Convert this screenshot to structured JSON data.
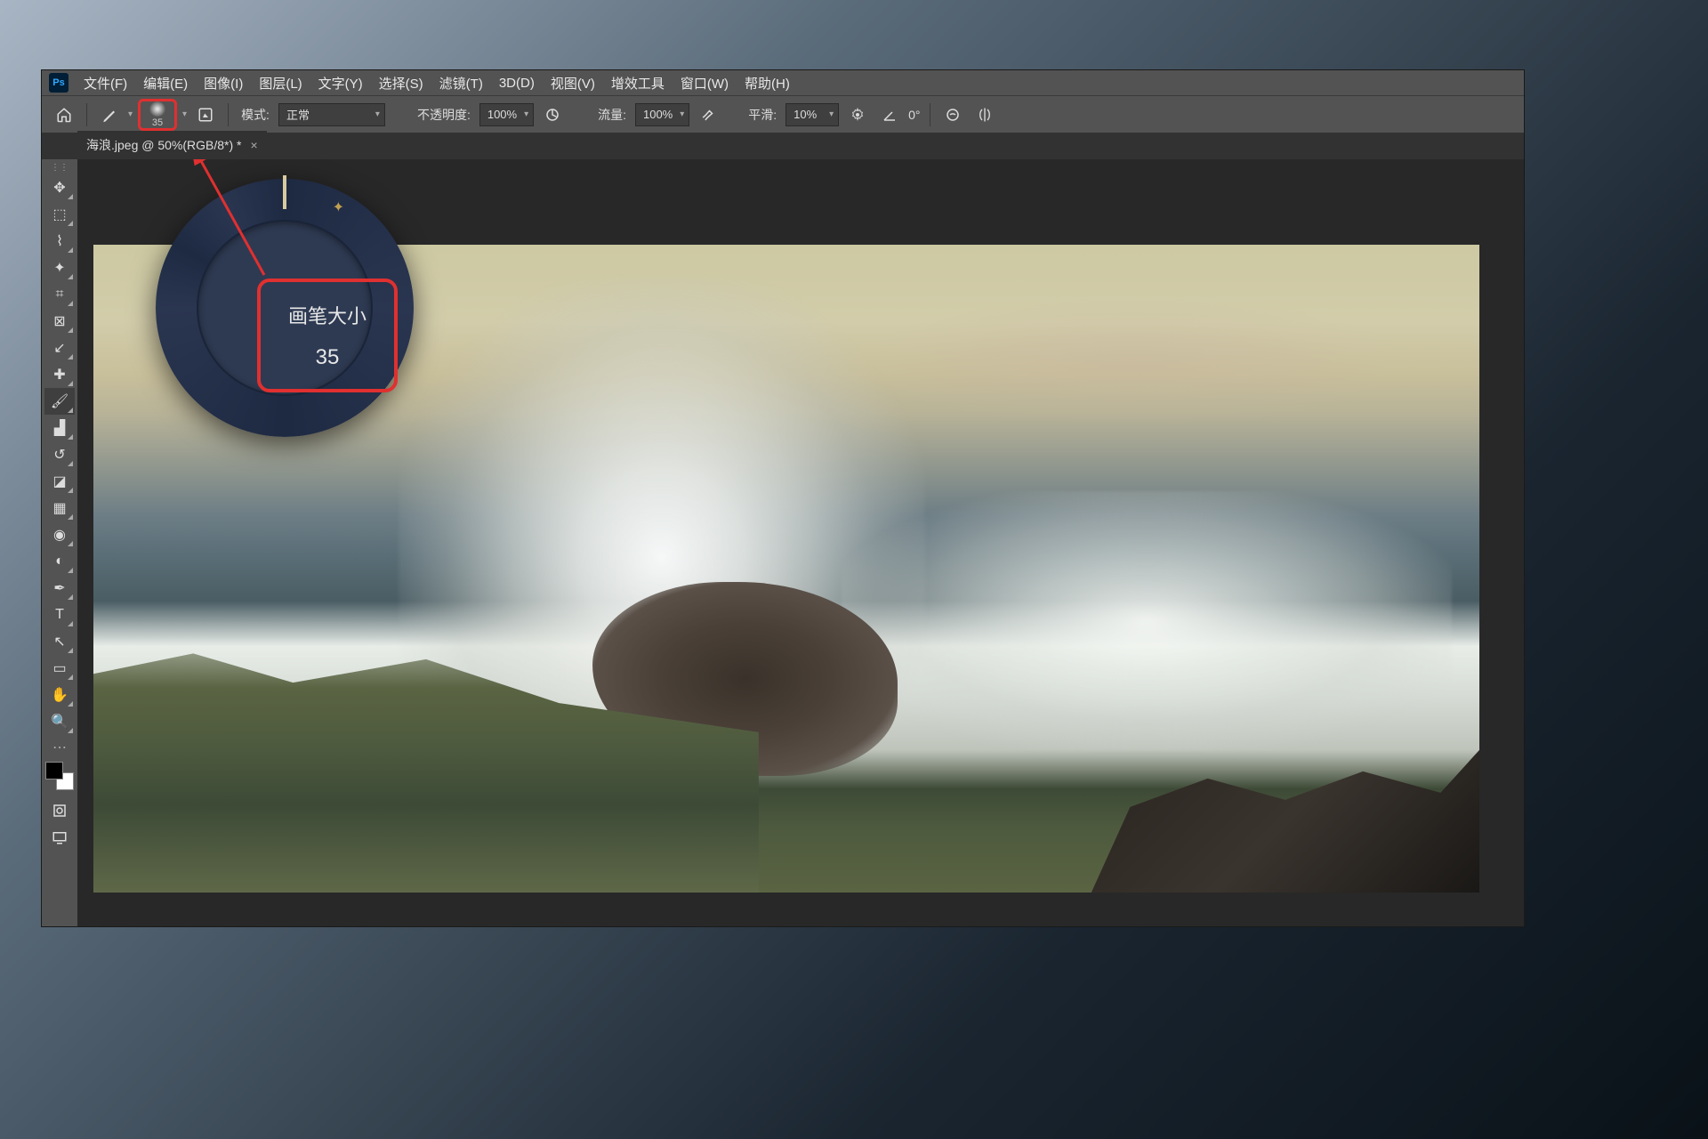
{
  "menus": [
    "文件(F)",
    "编辑(E)",
    "图像(I)",
    "图层(L)",
    "文字(Y)",
    "选择(S)",
    "滤镜(T)",
    "3D(D)",
    "视图(V)",
    "增效工具",
    "窗口(W)",
    "帮助(H)"
  ],
  "options": {
    "brush_size": "35",
    "mode_label": "模式:",
    "mode_value": "正常",
    "opacity_label": "不透明度:",
    "opacity_value": "100%",
    "flow_label": "流量:",
    "flow_value": "100%",
    "smooth_label": "平滑:",
    "smooth_value": "10%",
    "angle_value": "0°"
  },
  "tab": {
    "title": "海浪.jpeg @ 50%(RGB/8*) *"
  },
  "hud": {
    "label": "画笔大小",
    "value": "35"
  },
  "tools": [
    {
      "name": "move-tool",
      "glyph": "✥"
    },
    {
      "name": "marquee-tool",
      "glyph": "⬚"
    },
    {
      "name": "lasso-tool",
      "glyph": "⌇"
    },
    {
      "name": "quick-select-tool",
      "glyph": "✦"
    },
    {
      "name": "crop-tool",
      "glyph": "⌗"
    },
    {
      "name": "frame-tool",
      "glyph": "⊠"
    },
    {
      "name": "eyedropper-tool",
      "glyph": "↙"
    },
    {
      "name": "healing-tool",
      "glyph": "✚"
    },
    {
      "name": "brush-tool",
      "glyph": "🖌",
      "active": true
    },
    {
      "name": "stamp-tool",
      "glyph": "▟"
    },
    {
      "name": "history-brush-tool",
      "glyph": "↺"
    },
    {
      "name": "eraser-tool",
      "glyph": "◪"
    },
    {
      "name": "gradient-tool",
      "glyph": "▦"
    },
    {
      "name": "blur-tool",
      "glyph": "◉"
    },
    {
      "name": "dodge-tool",
      "glyph": "◐"
    },
    {
      "name": "pen-tool",
      "glyph": "✒"
    },
    {
      "name": "type-tool",
      "glyph": "T"
    },
    {
      "name": "path-select-tool",
      "glyph": "↖"
    },
    {
      "name": "shape-tool",
      "glyph": "▭"
    },
    {
      "name": "hand-tool",
      "glyph": "✋"
    },
    {
      "name": "zoom-tool",
      "glyph": "🔍"
    }
  ]
}
